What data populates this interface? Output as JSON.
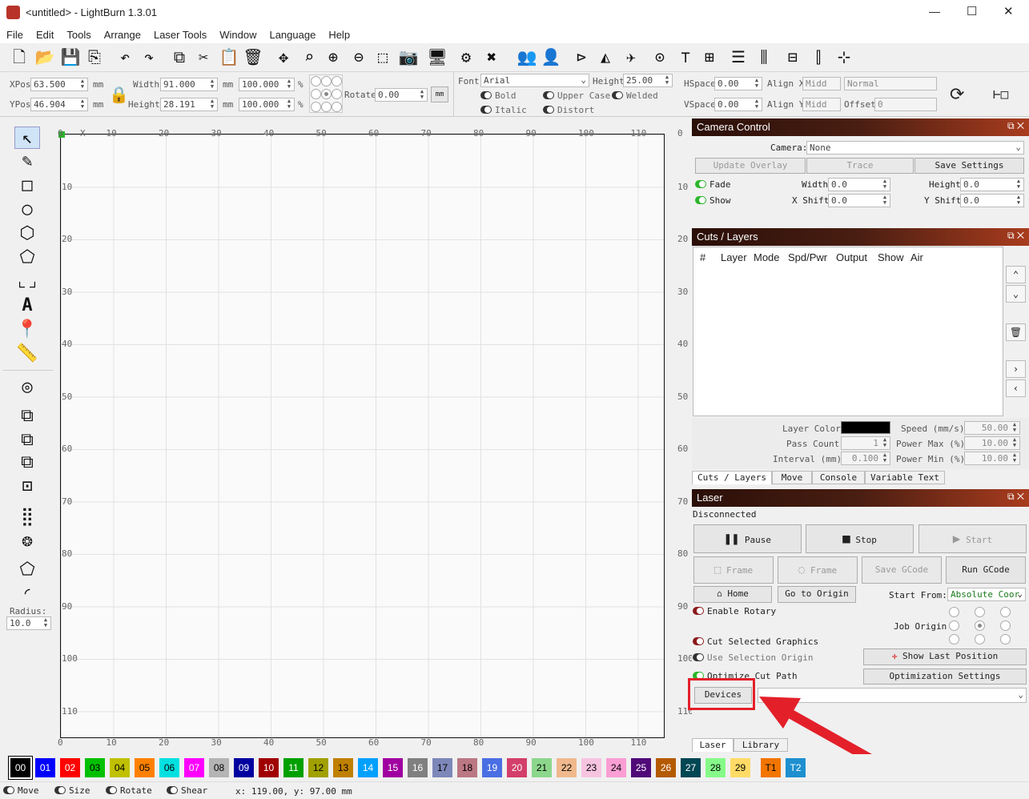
{
  "window": {
    "title": "<untitled> - LightBurn 1.3.01",
    "controls": {
      "minimize": "—",
      "maximize": "☐",
      "close": "✕"
    }
  },
  "menu": [
    "File",
    "Edit",
    "Tools",
    "Arrange",
    "Laser Tools",
    "Window",
    "Language",
    "Help"
  ],
  "toolbar_icons": [
    "new-file",
    "open",
    "save",
    "import",
    "undo",
    "redo",
    "copy",
    "cut",
    "paste",
    "delete",
    "move",
    "zoom-fit",
    "zoom-in",
    "zoom-out",
    "select-frame",
    "camera",
    "monitor",
    "settings",
    "tools",
    "group",
    "ungroup",
    "mirror-h",
    "mirror-v",
    "plane",
    "target",
    "align-top",
    "align-center",
    "distribute-h",
    "distribute-v",
    "align-edges",
    "align-middle",
    "distribute-center"
  ],
  "props": {
    "xpos_label": "XPos",
    "xpos": "63.500",
    "ypos_label": "YPos",
    "ypos": "46.904",
    "unit": "mm",
    "width_label": "Width",
    "width": "91.000",
    "height_label": "Height",
    "height": "28.191",
    "scale_w": "100.000",
    "scale_h": "100.000",
    "pct": "%",
    "rotate_label": "Rotate",
    "rotate": "0.00",
    "mm_btn": "mm",
    "font_label": "Font",
    "font": "Arial",
    "fheight_label": "Height",
    "fheight": "25.00",
    "bold": "Bold",
    "italic": "Italic",
    "upper": "Upper Case",
    "welded": "Welded",
    "distort": "Distort",
    "hspace_label": "HSpace",
    "hspace": "0.00",
    "vspace_label": "VSpace",
    "vspace": "0.00",
    "alignx_label": "Align X",
    "alignx": "Midd",
    "aligny_label": "Align Y",
    "aligny": "Midd",
    "normal": "Normal",
    "offset_label": "Offset",
    "offset": "0"
  },
  "ruler": {
    "x": [
      "0",
      "X",
      "10",
      "20",
      "30",
      "40",
      "50",
      "60",
      "70",
      "80",
      "90",
      "100",
      "110"
    ],
    "y": [
      "0",
      "10",
      "20",
      "30",
      "40",
      "50",
      "60",
      "70",
      "80",
      "90",
      "100",
      "110"
    ]
  },
  "radius": {
    "label": "Radius:",
    "value": "10.0"
  },
  "camera": {
    "title": "Camera Control",
    "camera_label": "Camera:",
    "camera_value": "None",
    "update_overlay": "Update Overlay",
    "trace": "Trace",
    "save_settings": "Save Settings",
    "fade": "Fade",
    "show": "Show",
    "width_label": "Width",
    "width": "0.0",
    "height_label": "Height",
    "height": "0.0",
    "xshift_label": "X Shift",
    "xshift": "0.0",
    "yshift_label": "Y Shift",
    "yshift": "0.0"
  },
  "cuts": {
    "title": "Cuts / Layers",
    "columns": [
      "#",
      "Layer",
      "Mode",
      "Spd/Pwr",
      "Output",
      "Show",
      "Air"
    ],
    "layer_color": "Layer Color",
    "pass_count": "Pass Count",
    "pass_value": "1",
    "interval": "Interval (mm)",
    "interval_value": "0.100",
    "speed": "Speed (mm/s)",
    "speed_value": "50.00",
    "pmax": "Power Max (%)",
    "pmax_value": "10.00",
    "pmin": "Power Min (%)",
    "pmin_value": "10.00",
    "tabs": [
      "Cuts / Layers",
      "Move",
      "Console",
      "Variable Text"
    ]
  },
  "laser": {
    "title": "Laser",
    "status": "Disconnected",
    "pause": "Pause",
    "stop": "Stop",
    "start": "Start",
    "frame1": "Frame",
    "frame2": "Frame",
    "save_gcode": "Save GCode",
    "run_gcode": "Run GCode",
    "home": "Home",
    "go_origin": "Go to Origin",
    "start_from_label": "Start From:",
    "start_from": "Absolute Coor",
    "enable_rotary": "Enable Rotary",
    "job_origin": "Job Origin",
    "cut_selected": "Cut Selected Graphics",
    "use_selection": "Use Selection Origin",
    "show_last": "Show Last Position",
    "optimize": "Optimize Cut Path",
    "opt_settings": "Optimization Settings",
    "devices": "Devices",
    "tabs": [
      "Laser",
      "Library"
    ]
  },
  "palette": [
    {
      "id": "00",
      "c": "#000000",
      "t": "#ffffff"
    },
    {
      "id": "01",
      "c": "#0000ff",
      "t": "#ffffff"
    },
    {
      "id": "02",
      "c": "#ff0000",
      "t": "#ffffff"
    },
    {
      "id": "03",
      "c": "#00c000",
      "t": "#000000"
    },
    {
      "id": "04",
      "c": "#c0c000",
      "t": "#000000"
    },
    {
      "id": "05",
      "c": "#ff8000",
      "t": "#000000"
    },
    {
      "id": "06",
      "c": "#00e0e0",
      "t": "#000000"
    },
    {
      "id": "07",
      "c": "#ff00ff",
      "t": "#ffffff"
    },
    {
      "id": "08",
      "c": "#b4b4b4",
      "t": "#000000"
    },
    {
      "id": "09",
      "c": "#0000a0",
      "t": "#ffffff"
    },
    {
      "id": "10",
      "c": "#a00000",
      "t": "#ffffff"
    },
    {
      "id": "11",
      "c": "#00a000",
      "t": "#ffffff"
    },
    {
      "id": "12",
      "c": "#a0a000",
      "t": "#000000"
    },
    {
      "id": "13",
      "c": "#c08000",
      "t": "#000000"
    },
    {
      "id": "14",
      "c": "#00a0ff",
      "t": "#ffffff"
    },
    {
      "id": "15",
      "c": "#a000a0",
      "t": "#ffffff"
    },
    {
      "id": "16",
      "c": "#808080",
      "t": "#ffffff"
    },
    {
      "id": "17",
      "c": "#7d87b9",
      "t": "#000000"
    },
    {
      "id": "18",
      "c": "#bb7784",
      "t": "#000000"
    },
    {
      "id": "19",
      "c": "#4a6fe3",
      "t": "#ffffff"
    },
    {
      "id": "20",
      "c": "#d33f6a",
      "t": "#ffffff"
    },
    {
      "id": "21",
      "c": "#8cd78c",
      "t": "#000000"
    },
    {
      "id": "22",
      "c": "#f0b98d",
      "t": "#000000"
    },
    {
      "id": "23",
      "c": "#f6c4e1",
      "t": "#000000"
    },
    {
      "id": "24",
      "c": "#fa9ed4",
      "t": "#000000"
    },
    {
      "id": "25",
      "c": "#500a78",
      "t": "#ffffff"
    },
    {
      "id": "26",
      "c": "#b45a00",
      "t": "#ffffff"
    },
    {
      "id": "27",
      "c": "#004754",
      "t": "#ffffff"
    },
    {
      "id": "28",
      "c": "#86fa88",
      "t": "#000000"
    },
    {
      "id": "29",
      "c": "#ffdb66",
      "t": "#000000"
    },
    {
      "id": "T1",
      "c": "#f37500",
      "t": "#000000"
    },
    {
      "id": "T2",
      "c": "#1e90d0",
      "t": "#ffffff"
    }
  ],
  "statusbar": {
    "move": "Move",
    "size": "Size",
    "rotate": "Rotate",
    "shear": "Shear",
    "coords": "x: 119.00, y: 97.00 mm"
  }
}
